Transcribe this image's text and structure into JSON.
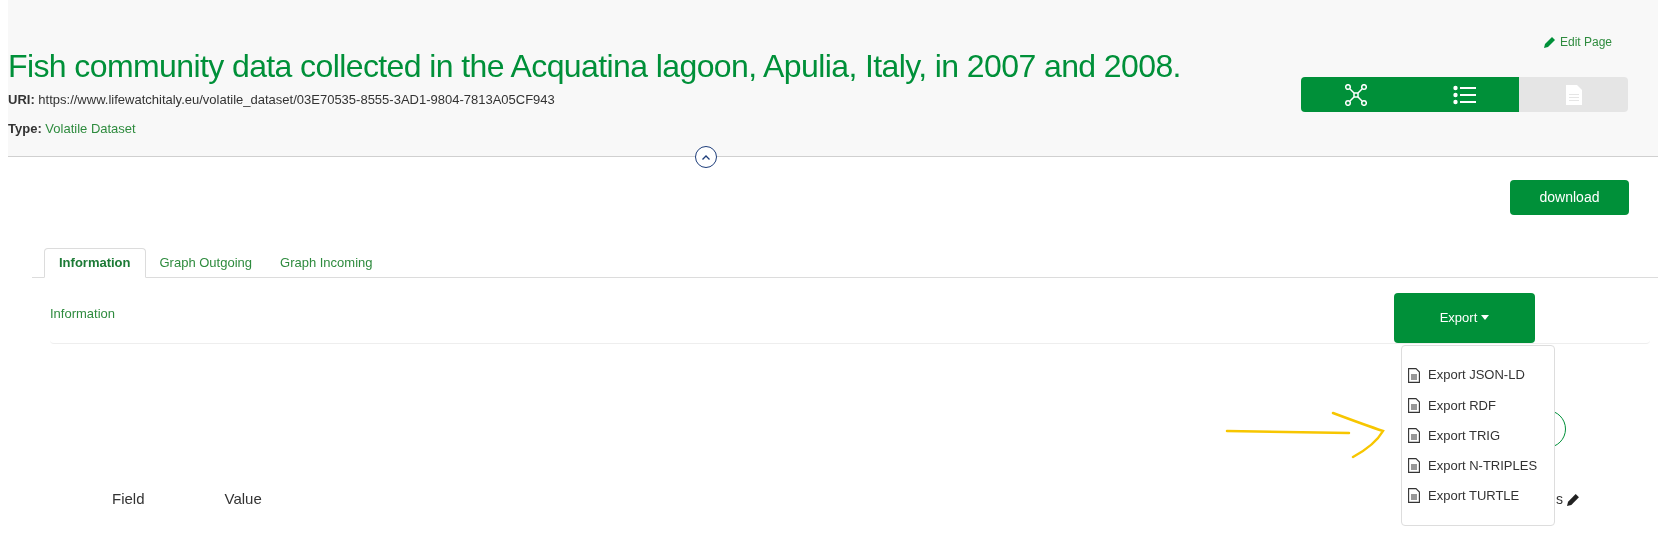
{
  "header": {
    "title": "Fish community data collected in the Acquatina lagoon, Apulia, Italy, in 2007 and 2008.",
    "uri_label": "URI:",
    "uri": "https://www.lifewatchitaly.eu/volatile_dataset/03E70535-8555-3AD1-9804-7813A05CF943",
    "type_label": "Type:",
    "type": "Volatile Dataset",
    "edit_link": "Edit Page"
  },
  "view_toggle": [
    {
      "kind": "graph",
      "selected": true
    },
    {
      "kind": "list",
      "selected": true
    },
    {
      "kind": "document",
      "selected": false
    }
  ],
  "download_button": "download",
  "tabs": [
    {
      "label": "Information",
      "selected": true
    },
    {
      "label": "Graph Outgoing",
      "selected": false
    },
    {
      "label": "Graph Incoming",
      "selected": false
    }
  ],
  "section_title": "Information",
  "export": {
    "label": "Export",
    "expanded": true,
    "items": [
      "Export JSON-LD",
      "Export RDF",
      "Export TRIG",
      "Export N-TRIPLES",
      "Export TURTLE"
    ]
  },
  "table_header": [
    "Field",
    "Value"
  ],
  "hidden_text": "s"
}
